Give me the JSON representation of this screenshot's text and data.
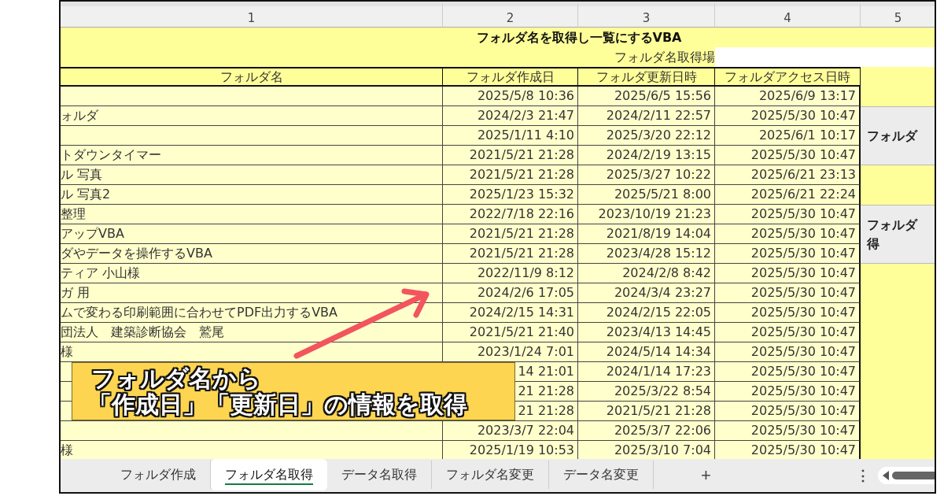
{
  "column_headers": [
    "1",
    "2",
    "3",
    "4",
    "5"
  ],
  "sheet": {
    "title": "フォルダ名を取得し一覧にするVBA",
    "location_label": "フォルダ名取得場"
  },
  "table": {
    "columns": [
      "フォルダ名",
      "フォルダ作成日",
      "フォルダ更新日時",
      "フォルダアクセス日時"
    ],
    "rows": [
      {
        "created": "2025/5/8 10:36",
        "modified": "2025/6/5 15:56",
        "accessed": "2025/6/9 13:17"
      },
      {
        "name": "ォルダ",
        "created": "2024/2/3 21:47",
        "modified": "2024/2/11 22:57",
        "accessed": "2025/5/30 10:47"
      },
      {
        "created": "2025/1/11 4:10",
        "modified": "2025/3/20 22:12",
        "accessed": "2025/6/1 10:17"
      },
      {
        "name": "トダウンタイマー",
        "created": "2021/5/21 21:28",
        "modified": "2024/2/19 13:15",
        "accessed": "2025/5/30 10:47"
      },
      {
        "name": "ル 写真",
        "created": "2021/5/21 21:28",
        "modified": "2025/3/27 10:22",
        "accessed": "2025/6/21 23:13"
      },
      {
        "name": "ル 写真2",
        "created": "2025/1/23 15:32",
        "modified": "2025/5/21 8:00",
        "accessed": "2025/6/21 22:24"
      },
      {
        "name": "整理",
        "created": "2022/7/18 22:16",
        "modified": "2023/10/19 21:23",
        "accessed": "2025/5/30 10:47"
      },
      {
        "name": "アップVBA",
        "created": "2021/5/21 21:28",
        "modified": "2021/8/19 14:04",
        "accessed": "2025/5/30 10:47"
      },
      {
        "name": "ダやデータを操作するVBA",
        "created": "2021/5/21 21:28",
        "modified": "2023/4/28 15:12",
        "accessed": "2025/5/30 10:47"
      },
      {
        "name": "ティア 小山様",
        "created": "2022/11/9 8:12",
        "modified": "2024/2/8 8:42",
        "accessed": "2025/5/30 10:47"
      },
      {
        "name": "ガ 用",
        "created": "2024/2/6 17:05",
        "modified": "2024/3/4 23:27",
        "accessed": "2025/5/30 10:47"
      },
      {
        "name": "ムで変わる印刷範囲に合わせてPDF出力するVBA",
        "created": "2024/2/15 14:31",
        "modified": "2024/2/15 22:05",
        "accessed": "2025/5/30 10:47"
      },
      {
        "name": "団法人　建築診断協会　鷲尾",
        "created": "2021/5/21 21:40",
        "modified": "2023/4/13 14:45",
        "accessed": "2025/5/30 10:47"
      },
      {
        "name": "様",
        "created": "2023/1/24 7:01",
        "modified": "2024/5/14 14:34",
        "accessed": "2025/5/30 10:47"
      },
      {
        "created": "14 21:01",
        "modified": "2024/1/14 17:23",
        "accessed": "2025/5/30 10:47"
      },
      {
        "created": "21 21:28",
        "modified": "2025/3/22 8:54",
        "accessed": "2025/5/30 10:47"
      },
      {
        "created": "21 21:28",
        "modified": "2021/5/21 21:28",
        "accessed": "2025/5/30 10:47"
      },
      {
        "created": "2023/3/7 22:04",
        "modified": "2025/3/7 22:06",
        "accessed": "2025/5/30 10:47"
      },
      {
        "name": "様",
        "created": "2025/1/19 10:53",
        "modified": "2025/3/10 7:04",
        "accessed": "2025/5/30 10:47"
      }
    ]
  },
  "side_buttons": [
    {
      "lines": [
        "フォルダ"
      ]
    },
    {
      "lines": [
        "フォルダ",
        "得"
      ]
    }
  ],
  "callout": {
    "lines": [
      "フォルダ名から",
      "「作成日」「更新日」の情報を取得"
    ]
  },
  "sheet_tabs": [
    {
      "label": "フォルダ作成",
      "selected": false
    },
    {
      "label": "フォルダ名取得",
      "selected": true
    },
    {
      "label": "データ名取得",
      "selected": false
    },
    {
      "label": "フォルダ名変更",
      "selected": false
    },
    {
      "label": "データ名変更",
      "selected": false
    }
  ],
  "add_sheet": "+",
  "more_menu": "⋮"
}
